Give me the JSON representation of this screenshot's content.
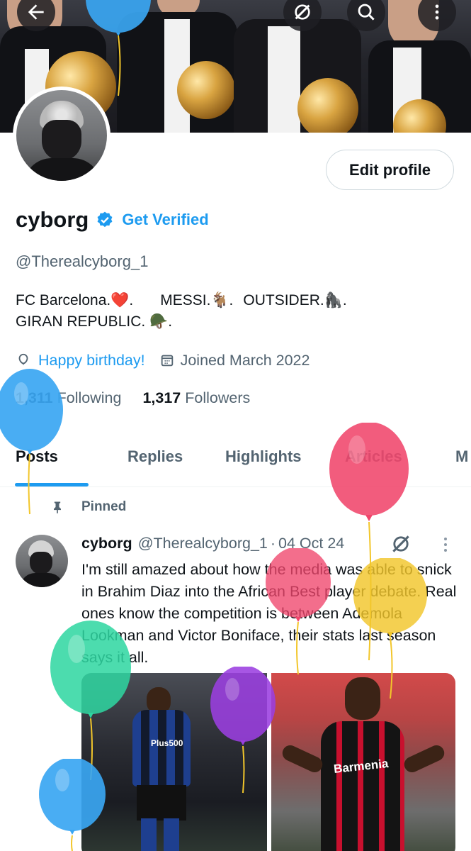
{
  "header": {
    "back_icon": "arrow-left-icon",
    "grok_icon": "grok-icon",
    "search_icon": "search-icon",
    "more_icon": "more-vertical-icon"
  },
  "profile": {
    "name": "cyborg",
    "get_verified_label": "Get Verified",
    "handle": "@Therealcyborg_1",
    "edit_profile_label": "Edit profile",
    "bio_line1_a": "FC Barcelona.❤️.",
    "bio_line1_b": "MESSI.🐐.",
    "bio_line1_c": "OUTSIDER.🦍.",
    "bio_line2": "GIRAN REPUBLIC. 🪖.",
    "birthday_label": "Happy birthday!",
    "joined_label": "Joined March 2022",
    "following_count": "1,311",
    "following_label": "Following",
    "followers_count": "1,317",
    "followers_label": "Followers"
  },
  "tabs": [
    {
      "label": "Posts",
      "active": true
    },
    {
      "label": "Replies"
    },
    {
      "label": "Highlights"
    },
    {
      "label": "Articles"
    },
    {
      "label": "M"
    }
  ],
  "pinned_post": {
    "pinned_label": "Pinned",
    "author_name": "cyborg",
    "author_handle": "@Therealcyborg_1",
    "separator": "·",
    "date": "04 Oct 24",
    "text": "I'm still amazed about how the media was able to snick in Brahim Diaz into the African Best player debate. Real ones know the competition is between Ademola Lookman and Victor Boniface, their stats last season says it all.",
    "image_left_caption": "Plus500",
    "image_right_caption": "Barmenia"
  },
  "colors": {
    "accent": "#1d9bf0",
    "text_primary": "#0f1419",
    "text_secondary": "#536471",
    "border": "#cfd9de",
    "balloon_blue": "#3aa6f2",
    "balloon_pink": "#f0456b",
    "balloon_yellow": "#f2c62b",
    "balloon_green": "#2fd6a1",
    "balloon_purple": "#9b3fe0"
  }
}
